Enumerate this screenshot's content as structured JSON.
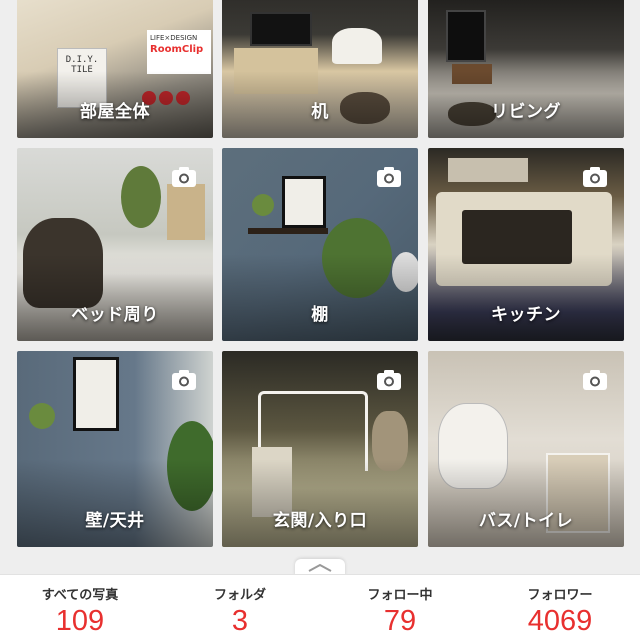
{
  "folders": [
    {
      "label": "部屋全体",
      "icon": "none"
    },
    {
      "label": "机",
      "icon": "none"
    },
    {
      "label": "リビング",
      "icon": "none"
    },
    {
      "label": "ベッド周り",
      "icon": "camera-icon"
    },
    {
      "label": "棚",
      "icon": "camera-icon"
    },
    {
      "label": "キッチン",
      "icon": "camera-icon"
    },
    {
      "label": "壁/天井",
      "icon": "camera-icon"
    },
    {
      "label": "玄関/入り口",
      "icon": "camera-icon"
    },
    {
      "label": "バス/トイレ",
      "icon": "camera-icon"
    }
  ],
  "top_tile_text": {
    "diy_tile": "D.I.Y. TILE",
    "life_design": "LIFE×DESIGN",
    "roomclip": "RoomClip"
  },
  "stats": [
    {
      "caption": "すべての写真",
      "value": "109"
    },
    {
      "caption": "フォルダ",
      "value": "3"
    },
    {
      "caption": "フォロー中",
      "value": "79"
    },
    {
      "caption": "フォロワー",
      "value": "4069"
    }
  ],
  "colors": {
    "accent": "#e8302f",
    "background": "#eeeeee"
  }
}
